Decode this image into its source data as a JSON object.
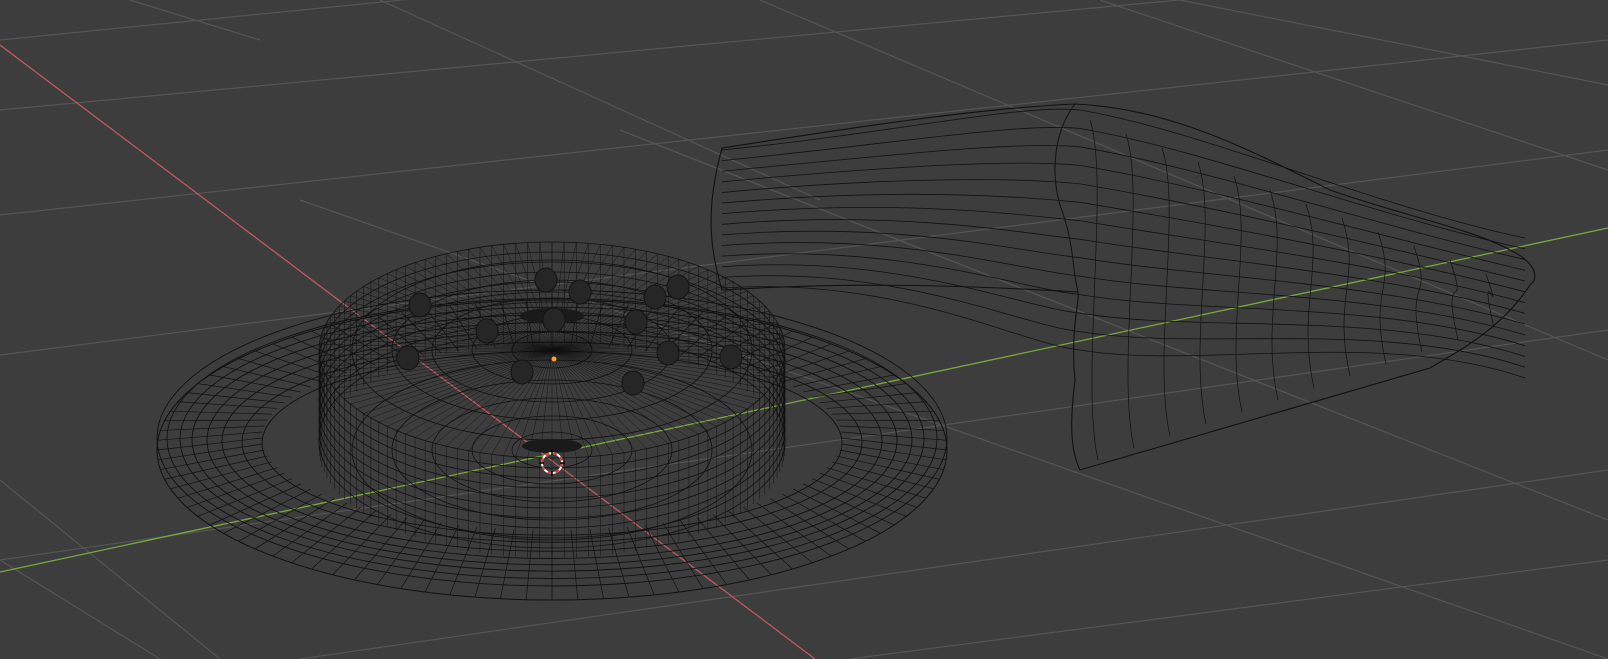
{
  "viewport": {
    "background": "#3d3d3d",
    "shading_mode": "wireframe"
  },
  "axes": {
    "x_axis_color": "#c0585f",
    "y_axis_color": "#7aa83e"
  },
  "grid": {
    "color": "#555555",
    "visible": true
  },
  "wireframe": {
    "color": "#111111"
  },
  "objects": [
    {
      "name": "plate",
      "kind": "wireframe-mesh"
    },
    {
      "name": "pastry",
      "kind": "wireframe-mesh"
    },
    {
      "name": "toppings",
      "kind": "dark-spheres"
    },
    {
      "name": "slab",
      "kind": "wireframe-mesh"
    }
  ],
  "origin_marker_color": "#ffa030",
  "cursor_3d": {
    "primary_color": "#ffffff",
    "secondary_color": "#d04040"
  }
}
